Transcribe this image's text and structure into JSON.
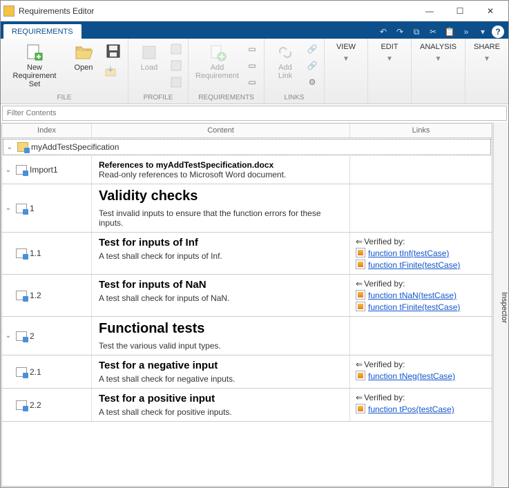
{
  "window": {
    "title": "Requirements Editor"
  },
  "ribbon": {
    "tab": "REQUIREMENTS",
    "quick": {
      "undo": "↶",
      "redo": "↷",
      "copy": "⧉",
      "cut": "✂",
      "paste": "📋",
      "more": "»"
    }
  },
  "toolbar": {
    "file": {
      "new": "New\nRequirement Set",
      "open": "Open",
      "save": "Save",
      "label": "FILE"
    },
    "profile": {
      "load": "Load",
      "label": "PROFILE"
    },
    "requirements": {
      "add": "Add\nRequirement",
      "label": "REQUIREMENTS"
    },
    "links": {
      "add": "Add\nLink",
      "label": "LINKS"
    },
    "view": "VIEW",
    "edit": "EDIT",
    "analysis": "ANALYSIS",
    "share": "SHARE"
  },
  "filter": {
    "placeholder": "Filter Contents"
  },
  "columns": {
    "index": "Index",
    "content": "Content",
    "links": "Links"
  },
  "inspector": "Inspector",
  "tree": {
    "root": "myAddTestSpecification",
    "import": {
      "idx": "Import1",
      "title": "References to myAddTestSpecification.docx",
      "desc": "Read-only references to Microsoft Word document."
    },
    "r1": {
      "idx": "1",
      "title": "Validity checks",
      "desc": "Test invalid inputs to ensure that the function errors for these inputs."
    },
    "r11": {
      "idx": "1.1",
      "title": "Test for inputs of Inf",
      "desc": "A test shall check for inputs of Inf.",
      "verify": "Verified by:",
      "links": [
        "function tInf(testCase)",
        "function tFinite(testCase)"
      ]
    },
    "r12": {
      "idx": "1.2",
      "title": "Test for inputs of NaN",
      "desc": "A test shall check for inputs of NaN.",
      "verify": "Verified by:",
      "links": [
        "function tNaN(testCase)",
        "function tFinite(testCase)"
      ]
    },
    "r2": {
      "idx": "2",
      "title": "Functional tests",
      "desc": "Test the various valid input types."
    },
    "r21": {
      "idx": "2.1",
      "title": "Test for a negative input",
      "desc": "A test shall check for negative inputs.",
      "verify": "Verified by:",
      "links": [
        "function tNeg(testCase)"
      ]
    },
    "r22": {
      "idx": "2.2",
      "title": "Test for a positive input",
      "desc": "A test shall check for positive inputs.",
      "verify": "Verified by:",
      "links": [
        "function tPos(testCase)"
      ]
    }
  }
}
